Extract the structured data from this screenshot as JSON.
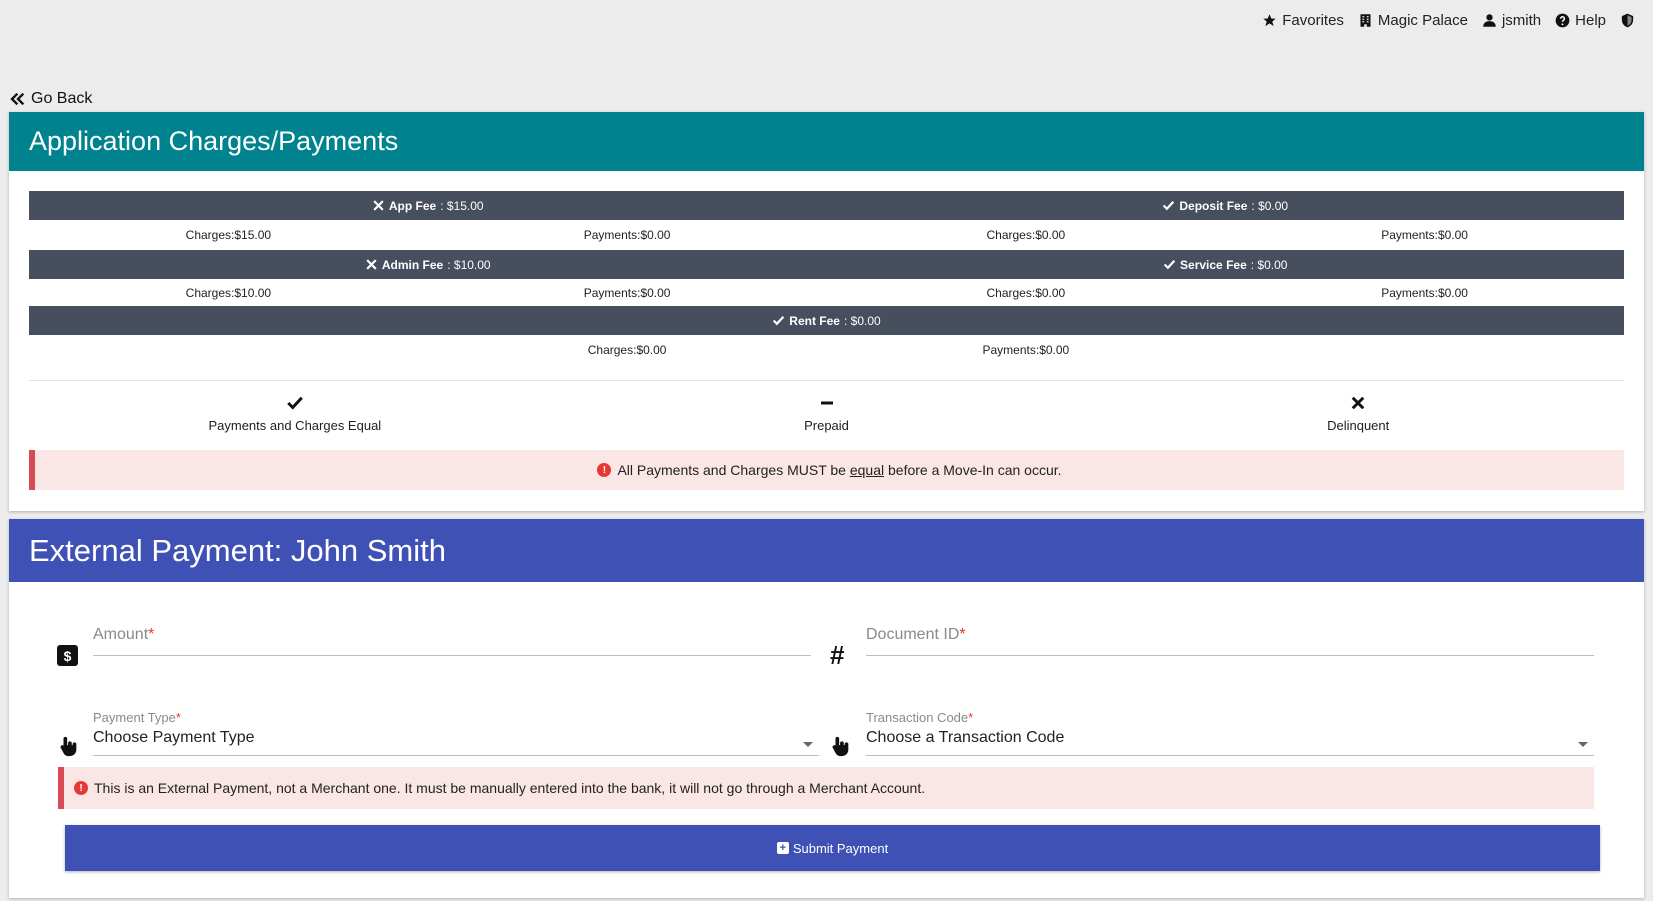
{
  "topnav": {
    "favorites": "Favorites",
    "property": "Magic Palace",
    "user": "jsmith",
    "help": "Help"
  },
  "goback": "Go Back",
  "charges_card": {
    "title": "Application Charges/Payments",
    "fees": [
      {
        "name": "App Fee",
        "value": ": $15.00",
        "status": "x-icon",
        "charges_label": "Charges",
        "charges": ":$15.00",
        "payments_label": "Payments",
        "payments": ":$0.00"
      },
      {
        "name": "Deposit Fee",
        "value": ": $0.00",
        "status": "check-icon",
        "charges_label": "Charges",
        "charges": ":$0.00",
        "payments_label": "Payments",
        "payments": ":$0.00"
      },
      {
        "name": "Admin Fee",
        "value": ": $10.00",
        "status": "x-icon",
        "charges_label": "Charges",
        "charges": ":$10.00",
        "payments_label": "Payments",
        "payments": ":$0.00"
      },
      {
        "name": "Service Fee",
        "value": ": $0.00",
        "status": "check-icon",
        "charges_label": "Charges",
        "charges": ":$0.00",
        "payments_label": "Payments",
        "payments": ":$0.00"
      },
      {
        "name": "Rent Fee",
        "value": ": $0.00",
        "status": "check-icon",
        "charges_label": "Charges",
        "charges": ":$0.00",
        "payments_label": "Payments",
        "payments": ":$0.00"
      }
    ],
    "legend": {
      "equal": "Payments and Charges Equal",
      "prepaid": "Prepaid",
      "delinquent": "Delinquent"
    },
    "alert": {
      "before": "All Payments and Charges MUST be ",
      "emph": "equal",
      "after": " before a Move-In can occur."
    }
  },
  "payment_card": {
    "title": "External Payment: John Smith",
    "amount": {
      "label": "Amount",
      "required": "*"
    },
    "document_id": {
      "label": "Document ID",
      "required": "*"
    },
    "payment_type": {
      "label": "Payment Type",
      "required": "*",
      "value": "Choose Payment Type"
    },
    "transaction_code": {
      "label": "Transaction Code",
      "required": "*",
      "value": "Choose a Transaction Code"
    },
    "alert": "This is an External Payment, not a Merchant one. It must be manually entered into the bank, it will not go through a Merchant Account.",
    "submit": "Submit Payment"
  },
  "colors": {
    "teal_header": "#00838f",
    "indigo_header": "#3f51b5",
    "fee_bar": "#474e5d",
    "alert_bg": "#fbe6e6",
    "alert_border": "#d84a55"
  }
}
